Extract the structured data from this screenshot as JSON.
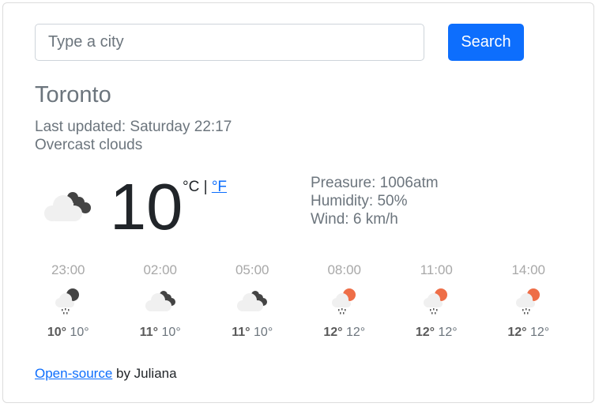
{
  "search": {
    "placeholder": "Type a city",
    "value": "",
    "button_label": "Search"
  },
  "current": {
    "city": "Toronto",
    "last_updated": "Last updated: Saturday 22:17",
    "description": "Overcast clouds",
    "icon": "overcast-clouds-icon",
    "temperature": "10",
    "unit_celsius": "°C",
    "unit_separator": "|",
    "unit_fahrenheit": "°F",
    "pressure": "Preasure: 1006atm",
    "humidity": "Humidity: 50%",
    "wind": "Wind: 6 km/h"
  },
  "forecast": [
    {
      "time": "23:00",
      "icon": "night-rain-icon",
      "max": "10°",
      "min": "10°"
    },
    {
      "time": "02:00",
      "icon": "broken-clouds-icon",
      "max": "11°",
      "min": "10°"
    },
    {
      "time": "05:00",
      "icon": "broken-clouds-icon",
      "max": "11°",
      "min": "10°"
    },
    {
      "time": "08:00",
      "icon": "day-rain-icon",
      "max": "12°",
      "min": "12°"
    },
    {
      "time": "11:00",
      "icon": "day-rain-icon",
      "max": "12°",
      "min": "12°"
    },
    {
      "time": "14:00",
      "icon": "day-rain-icon",
      "max": "12°",
      "min": "12°"
    }
  ],
  "footer": {
    "link_text": "Open-source",
    "suffix": " by Juliana"
  },
  "colors": {
    "accent": "#0d6efd",
    "sun": "#ee6e48",
    "dark_cloud": "#444444",
    "light_cloud": "#f0f0f0"
  }
}
